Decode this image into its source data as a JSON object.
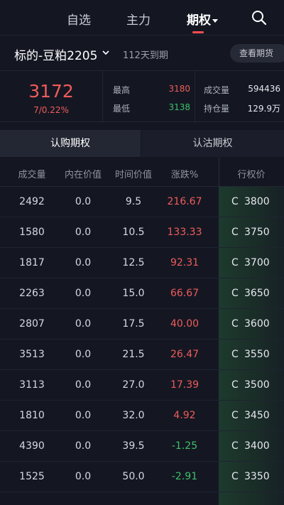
{
  "nav": {
    "tabs": [
      "自选",
      "主力",
      "期权"
    ],
    "active_index": 2
  },
  "underlying": {
    "name": "标的-豆粕2205",
    "expiry": "112天到期",
    "futures_button": "查看期货"
  },
  "quote": {
    "price": "3172",
    "change": "7/0.22%",
    "high_label": "最高",
    "high": "3180",
    "low_label": "最低",
    "low": "3138",
    "volume_label": "成交量",
    "volume": "594436",
    "oi_label": "持仓量",
    "oi": "129.9万"
  },
  "subtabs": [
    "认购期权",
    "认沽期权"
  ],
  "columns": [
    "成交量",
    "内在价值",
    "时间价值",
    "涨跌%",
    "行权价"
  ],
  "rows": [
    {
      "vol": "2492",
      "intrinsic": "0.0",
      "time": "9.5",
      "chg": "216.67",
      "dir": "up",
      "cp": "C",
      "strike": "3800"
    },
    {
      "vol": "1580",
      "intrinsic": "0.0",
      "time": "10.5",
      "chg": "133.33",
      "dir": "up",
      "cp": "C",
      "strike": "3750"
    },
    {
      "vol": "1817",
      "intrinsic": "0.0",
      "time": "12.5",
      "chg": "92.31",
      "dir": "up",
      "cp": "C",
      "strike": "3700"
    },
    {
      "vol": "2263",
      "intrinsic": "0.0",
      "time": "15.0",
      "chg": "66.67",
      "dir": "up",
      "cp": "C",
      "strike": "3650"
    },
    {
      "vol": "2807",
      "intrinsic": "0.0",
      "time": "17.5",
      "chg": "40.00",
      "dir": "up",
      "cp": "C",
      "strike": "3600"
    },
    {
      "vol": "3513",
      "intrinsic": "0.0",
      "time": "21.5",
      "chg": "26.47",
      "dir": "up",
      "cp": "C",
      "strike": "3550"
    },
    {
      "vol": "3113",
      "intrinsic": "0.0",
      "time": "27.0",
      "chg": "17.39",
      "dir": "up",
      "cp": "C",
      "strike": "3500"
    },
    {
      "vol": "1810",
      "intrinsic": "0.0",
      "time": "32.0",
      "chg": "4.92",
      "dir": "up",
      "cp": "C",
      "strike": "3450"
    },
    {
      "vol": "4390",
      "intrinsic": "0.0",
      "time": "39.5",
      "chg": "-1.25",
      "dir": "down",
      "cp": "C",
      "strike": "3400"
    },
    {
      "vol": "1525",
      "intrinsic": "0.0",
      "time": "50.0",
      "chg": "-2.91",
      "dir": "down",
      "cp": "C",
      "strike": "3350"
    }
  ],
  "colors": {
    "up": "#ef5b5b",
    "down": "#3fbf6a",
    "background": "#141722"
  }
}
